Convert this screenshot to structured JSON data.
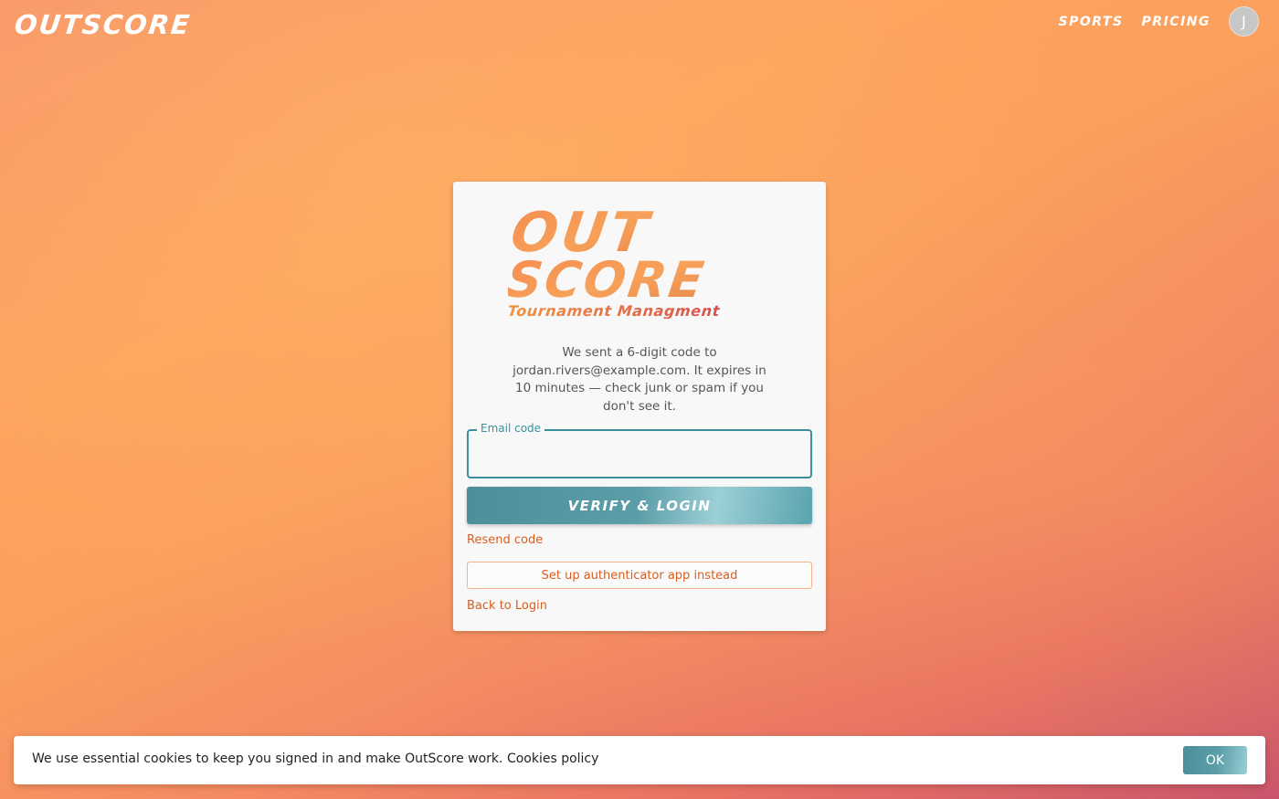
{
  "header": {
    "brand": "OUTSCORE",
    "nav": [
      {
        "label": "SPORTS"
      },
      {
        "label": "PRICING"
      }
    ],
    "avatar_initial": "J"
  },
  "card": {
    "logo": {
      "line1": "OUT",
      "line2": "SCORE",
      "tagline": "Tournament Managment"
    },
    "message": "We sent a 6-digit code to jordan.rivers@example.com. It expires in 10 minutes — check junk or spam if you don't see it.",
    "code_field": {
      "label": "Email code",
      "value": ""
    },
    "verify_label": "VERIFY & LOGIN",
    "resend_label": "Resend code",
    "authenticator_label": "Set up authenticator app instead",
    "back_label": "Back to Login"
  },
  "cookie_banner": {
    "text": "We use essential cookies to keep you signed in and make OutScore work. Cookies policy",
    "ok_label": "OK"
  },
  "colors": {
    "accent_teal": "#3b8f9b",
    "link_orange": "#d75e1f",
    "logo_orange": "#f58b4f",
    "logo_red": "#d8514f"
  }
}
